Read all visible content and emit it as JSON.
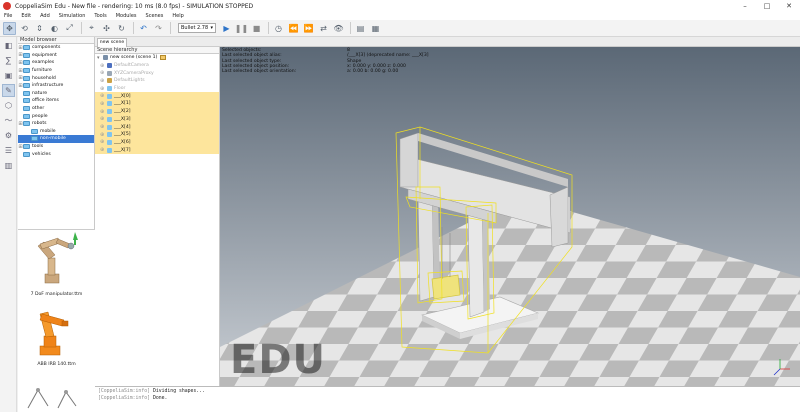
{
  "window": {
    "title": "CoppeliaSim Edu - New file - rendering: 10 ms (8.0 fps) - SIMULATION STOPPED",
    "controls": [
      "–",
      "□",
      "✕"
    ]
  },
  "menu": [
    "File",
    "Edit",
    "Add",
    "Simulation",
    "Tools",
    "Modules",
    "Scenes",
    "Help"
  ],
  "toolbar": {
    "engine": "Bullet 2.78"
  },
  "model_browser": {
    "header": "Model browser",
    "items": [
      {
        "label": "components",
        "expandable": true
      },
      {
        "label": "equipment",
        "expandable": true
      },
      {
        "label": "examples",
        "expandable": true
      },
      {
        "label": "furniture",
        "expandable": true
      },
      {
        "label": "household",
        "expandable": true
      },
      {
        "label": "infrastructure",
        "expandable": true
      },
      {
        "label": "nature",
        "expandable": false
      },
      {
        "label": "office items",
        "expandable": false
      },
      {
        "label": "other",
        "expandable": false
      },
      {
        "label": "people",
        "expandable": false
      },
      {
        "label": "robots",
        "expandable": true
      },
      {
        "label": "mobile",
        "expandable": false,
        "indent": 1
      },
      {
        "label": "non-mobile",
        "expandable": false,
        "indent": 1,
        "selected": true
      },
      {
        "label": "tools",
        "expandable": true
      },
      {
        "label": "vehicles",
        "expandable": false
      }
    ],
    "thumbnails": [
      {
        "label": "7 DoF manipulator.ttm"
      },
      {
        "label": "ABB IRB 140.ttm"
      }
    ]
  },
  "scene_tab": "new scene",
  "scene_hierarchy": {
    "header": "Scene hierarchy",
    "root": "new scene (scene 1)",
    "items": [
      {
        "label": "DefaultCamera",
        "gray": true,
        "color": "#4c6fbf"
      },
      {
        "label": "XYZCameraProxy",
        "gray": true,
        "color": "#9aa7b5"
      },
      {
        "label": "DefaultLights",
        "gray": true,
        "color": "#caa246"
      },
      {
        "label": "Floor",
        "gray": true,
        "color": "#7fc4ef"
      },
      {
        "label": "___X[0]",
        "gray": false,
        "color": "#7fc4ef"
      },
      {
        "label": "___X[1]",
        "gray": false,
        "color": "#7fc4ef"
      },
      {
        "label": "___X[2]",
        "gray": false,
        "color": "#7fc4ef"
      },
      {
        "label": "___X[3]",
        "gray": false,
        "color": "#7fc4ef"
      },
      {
        "label": "___X[4]",
        "gray": false,
        "color": "#7fc4ef"
      },
      {
        "label": "___X[5]",
        "gray": false,
        "color": "#7fc4ef"
      },
      {
        "label": "___X[6]",
        "gray": false,
        "color": "#7fc4ef"
      },
      {
        "label": "___X[7]",
        "gray": false,
        "color": "#7fc4ef"
      }
    ]
  },
  "info_overlay": {
    "lines": [
      {
        "label": "Selected objects:",
        "value": "8"
      },
      {
        "label": "Last selected object alias:",
        "value": "/___X[3]    (deprecated name: ___X[3]"
      },
      {
        "label": "Last selected object type:",
        "value": "Shape"
      },
      {
        "label": "Last selected object position:",
        "value": "x: 0.000    y: 0.000    z: 0.000"
      },
      {
        "label": "Last selected object orientation:",
        "value": "a: 0.00    b: 0.00    g: 0.00"
      }
    ]
  },
  "watermark": "EDU",
  "console": {
    "lines": [
      {
        "prefix": "[CoppeliaSim:info]",
        "text": "Dividing shapes..."
      },
      {
        "prefix": "[CoppeliaSim:info]",
        "text": "Done."
      }
    ]
  },
  "colors": {
    "sky_top": "#5b6876",
    "sky_bottom": "#c9ced4",
    "floor_light": "#e6e6e6",
    "floor_dark": "#b9b9b9",
    "selection_highlight": "#fde59c",
    "bbox_yellow": "#f0e020"
  }
}
